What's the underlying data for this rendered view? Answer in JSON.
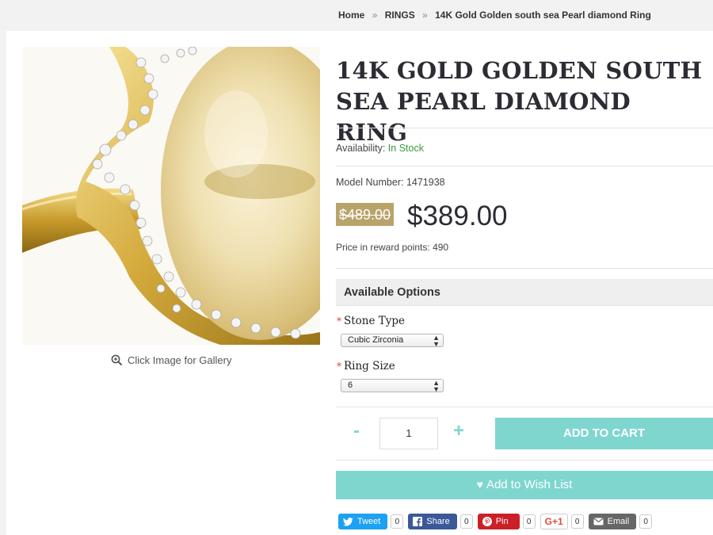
{
  "breadcrumb": {
    "items": [
      "Home",
      "RINGS",
      "14K Gold Golden south sea Pearl diamond Ring"
    ],
    "separator": "»"
  },
  "product": {
    "title": "14K Gold Golden South Sea Pearl Diamond Ring",
    "image_alt": "Golden south sea pearl ring with diamond halo",
    "gallery_label": "Click Image for Gallery",
    "availability_label": "Availability:",
    "availability_value": "In Stock",
    "model_label": "Model Number:",
    "model_value": "1471938",
    "old_price": "$489.00",
    "new_price": "$389.00",
    "reward_label": "Price in reward points:",
    "reward_value": "490"
  },
  "options": {
    "heading": "Available Options",
    "stone_type": {
      "label": "Stone Type",
      "required_mark": "*",
      "selected": "Cubic Zirconia"
    },
    "ring_size": {
      "label": "Ring Size",
      "required_mark": "*",
      "selected": "6"
    }
  },
  "cart": {
    "minus": "-",
    "plus": "+",
    "quantity": "1",
    "add_label": "ADD TO CART",
    "wishlist_label": "Add to Wish List"
  },
  "share": [
    {
      "label": "Tweet",
      "count": "0",
      "color": "#1da1f2",
      "icon": "twitter-icon"
    },
    {
      "label": "Share",
      "count": "0",
      "color": "#3b5998",
      "icon": "facebook-icon"
    },
    {
      "label": "Pin",
      "count": "0",
      "color": "#cb2027",
      "icon": "pinterest-icon"
    },
    {
      "label": "G+1",
      "count": "0",
      "color": "#ffffff",
      "icon": "google-plus-icon"
    },
    {
      "label": "Email",
      "count": "0",
      "color": "#666666",
      "icon": "email-icon"
    }
  ],
  "colors": {
    "accent": "#7fd6cf",
    "old_price_bg": "#b8a36a",
    "in_stock": "#3a9a3a",
    "required": "#e0403a"
  }
}
